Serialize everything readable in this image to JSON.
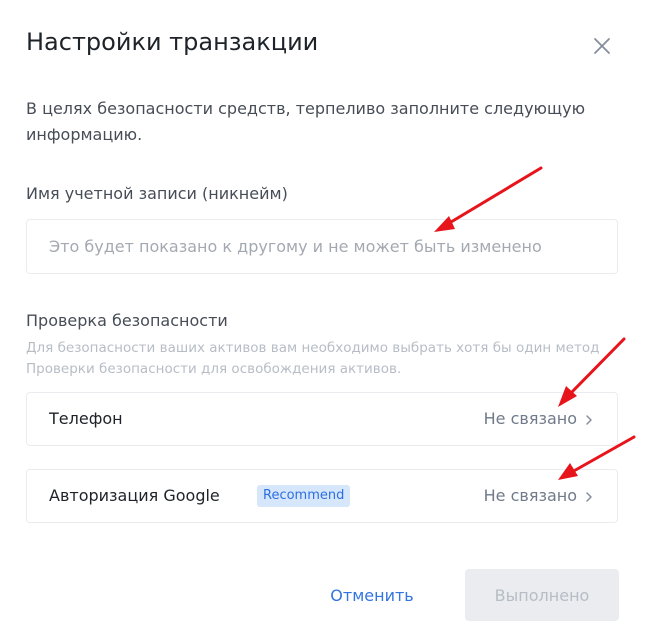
{
  "dialog": {
    "title": "Настройки транзакции",
    "intro": "В целях безопасности средств, терпеливо заполните следующую информацию."
  },
  "nickname": {
    "label": "Имя учетной записи (никнейм)",
    "placeholder": "Это будет показано к другому и не может быть изменено",
    "value": ""
  },
  "security": {
    "title": "Проверка безопасности",
    "description": "Для безопасности ваших активов вам необходимо выбрать хотя бы один метод Проверки безопасности для освобождения активов.",
    "options": [
      {
        "label": "Телефон",
        "status": "Не связано",
        "icon": "chevron-right-icon"
      },
      {
        "label": "Авторизация Google",
        "badge": "Recommend",
        "status": "Не связано",
        "icon": "chevron-right-icon"
      }
    ]
  },
  "footer": {
    "cancel_label": "Отменить",
    "done_label": "Выполнено"
  },
  "colors": {
    "accent": "#3375e0",
    "annotation_arrow": "#e8141b",
    "badge_bg": "#d6e6fb",
    "disabled_bg": "#eaecef"
  }
}
